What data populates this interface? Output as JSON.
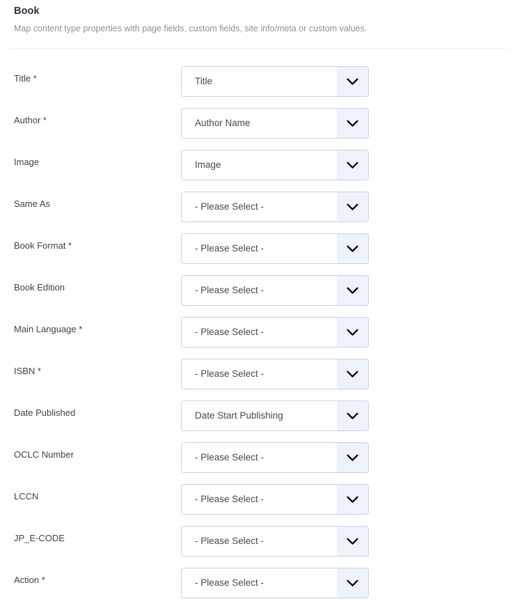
{
  "header": {
    "title": "Book",
    "subtitle": "Map content type properties with page fields, custom fields, site info/meta or custom values."
  },
  "colors": {
    "title": "#27313f",
    "subtitle": "#8b9099",
    "label": "#3e4248",
    "select_border": "#c3d3e6",
    "select_arrow_bg": "#eef2fa",
    "divider": "#edeff2",
    "background": "#ffffff"
  },
  "icons": {
    "chevron_down": "chevron-down-icon"
  },
  "form": {
    "rows": [
      {
        "label": "Title *",
        "value": "Title"
      },
      {
        "label": "Author *",
        "value": "Author Name"
      },
      {
        "label": "Image",
        "value": "Image"
      },
      {
        "label": "Same As",
        "value": "- Please Select -"
      },
      {
        "label": "Book Format *",
        "value": "- Please Select -"
      },
      {
        "label": "Book Edition",
        "value": "- Please Select -"
      },
      {
        "label": "Main Language *",
        "value": "- Please Select -"
      },
      {
        "label": "ISBN *",
        "value": "- Please Select -"
      },
      {
        "label": "Date Published",
        "value": "Date Start Publishing"
      },
      {
        "label": "OCLC Number",
        "value": "- Please Select -"
      },
      {
        "label": "LCCN",
        "value": "- Please Select -"
      },
      {
        "label": "JP_E-CODE",
        "value": "- Please Select -"
      },
      {
        "label": "Action *",
        "value": "- Please Select -"
      }
    ]
  }
}
